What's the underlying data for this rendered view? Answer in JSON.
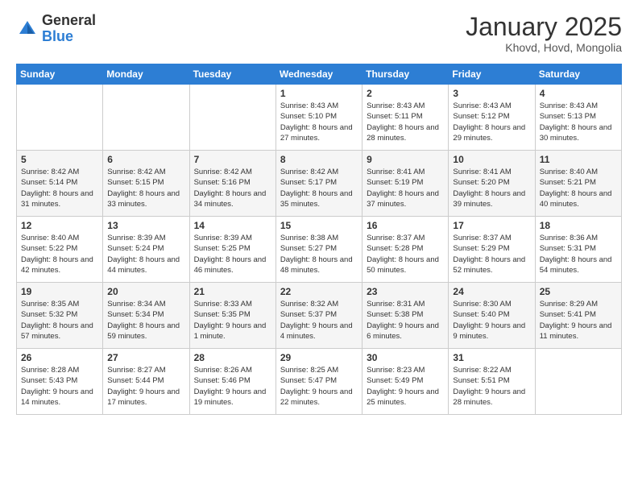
{
  "logo": {
    "general": "General",
    "blue": "Blue"
  },
  "header": {
    "title": "January 2025",
    "location": "Khovd, Hovd, Mongolia"
  },
  "weekdays": [
    "Sunday",
    "Monday",
    "Tuesday",
    "Wednesday",
    "Thursday",
    "Friday",
    "Saturday"
  ],
  "weeks": [
    [
      {
        "day": "",
        "info": ""
      },
      {
        "day": "",
        "info": ""
      },
      {
        "day": "",
        "info": ""
      },
      {
        "day": "1",
        "info": "Sunrise: 8:43 AM\nSunset: 5:10 PM\nDaylight: 8 hours\nand 27 minutes."
      },
      {
        "day": "2",
        "info": "Sunrise: 8:43 AM\nSunset: 5:11 PM\nDaylight: 8 hours\nand 28 minutes."
      },
      {
        "day": "3",
        "info": "Sunrise: 8:43 AM\nSunset: 5:12 PM\nDaylight: 8 hours\nand 29 minutes."
      },
      {
        "day": "4",
        "info": "Sunrise: 8:43 AM\nSunset: 5:13 PM\nDaylight: 8 hours\nand 30 minutes."
      }
    ],
    [
      {
        "day": "5",
        "info": "Sunrise: 8:42 AM\nSunset: 5:14 PM\nDaylight: 8 hours\nand 31 minutes."
      },
      {
        "day": "6",
        "info": "Sunrise: 8:42 AM\nSunset: 5:15 PM\nDaylight: 8 hours\nand 33 minutes."
      },
      {
        "day": "7",
        "info": "Sunrise: 8:42 AM\nSunset: 5:16 PM\nDaylight: 8 hours\nand 34 minutes."
      },
      {
        "day": "8",
        "info": "Sunrise: 8:42 AM\nSunset: 5:17 PM\nDaylight: 8 hours\nand 35 minutes."
      },
      {
        "day": "9",
        "info": "Sunrise: 8:41 AM\nSunset: 5:19 PM\nDaylight: 8 hours\nand 37 minutes."
      },
      {
        "day": "10",
        "info": "Sunrise: 8:41 AM\nSunset: 5:20 PM\nDaylight: 8 hours\nand 39 minutes."
      },
      {
        "day": "11",
        "info": "Sunrise: 8:40 AM\nSunset: 5:21 PM\nDaylight: 8 hours\nand 40 minutes."
      }
    ],
    [
      {
        "day": "12",
        "info": "Sunrise: 8:40 AM\nSunset: 5:22 PM\nDaylight: 8 hours\nand 42 minutes."
      },
      {
        "day": "13",
        "info": "Sunrise: 8:39 AM\nSunset: 5:24 PM\nDaylight: 8 hours\nand 44 minutes."
      },
      {
        "day": "14",
        "info": "Sunrise: 8:39 AM\nSunset: 5:25 PM\nDaylight: 8 hours\nand 46 minutes."
      },
      {
        "day": "15",
        "info": "Sunrise: 8:38 AM\nSunset: 5:27 PM\nDaylight: 8 hours\nand 48 minutes."
      },
      {
        "day": "16",
        "info": "Sunrise: 8:37 AM\nSunset: 5:28 PM\nDaylight: 8 hours\nand 50 minutes."
      },
      {
        "day": "17",
        "info": "Sunrise: 8:37 AM\nSunset: 5:29 PM\nDaylight: 8 hours\nand 52 minutes."
      },
      {
        "day": "18",
        "info": "Sunrise: 8:36 AM\nSunset: 5:31 PM\nDaylight: 8 hours\nand 54 minutes."
      }
    ],
    [
      {
        "day": "19",
        "info": "Sunrise: 8:35 AM\nSunset: 5:32 PM\nDaylight: 8 hours\nand 57 minutes."
      },
      {
        "day": "20",
        "info": "Sunrise: 8:34 AM\nSunset: 5:34 PM\nDaylight: 8 hours\nand 59 minutes."
      },
      {
        "day": "21",
        "info": "Sunrise: 8:33 AM\nSunset: 5:35 PM\nDaylight: 9 hours\nand 1 minute."
      },
      {
        "day": "22",
        "info": "Sunrise: 8:32 AM\nSunset: 5:37 PM\nDaylight: 9 hours\nand 4 minutes."
      },
      {
        "day": "23",
        "info": "Sunrise: 8:31 AM\nSunset: 5:38 PM\nDaylight: 9 hours\nand 6 minutes."
      },
      {
        "day": "24",
        "info": "Sunrise: 8:30 AM\nSunset: 5:40 PM\nDaylight: 9 hours\nand 9 minutes."
      },
      {
        "day": "25",
        "info": "Sunrise: 8:29 AM\nSunset: 5:41 PM\nDaylight: 9 hours\nand 11 minutes."
      }
    ],
    [
      {
        "day": "26",
        "info": "Sunrise: 8:28 AM\nSunset: 5:43 PM\nDaylight: 9 hours\nand 14 minutes."
      },
      {
        "day": "27",
        "info": "Sunrise: 8:27 AM\nSunset: 5:44 PM\nDaylight: 9 hours\nand 17 minutes."
      },
      {
        "day": "28",
        "info": "Sunrise: 8:26 AM\nSunset: 5:46 PM\nDaylight: 9 hours\nand 19 minutes."
      },
      {
        "day": "29",
        "info": "Sunrise: 8:25 AM\nSunset: 5:47 PM\nDaylight: 9 hours\nand 22 minutes."
      },
      {
        "day": "30",
        "info": "Sunrise: 8:23 AM\nSunset: 5:49 PM\nDaylight: 9 hours\nand 25 minutes."
      },
      {
        "day": "31",
        "info": "Sunrise: 8:22 AM\nSunset: 5:51 PM\nDaylight: 9 hours\nand 28 minutes."
      },
      {
        "day": "",
        "info": ""
      }
    ]
  ]
}
